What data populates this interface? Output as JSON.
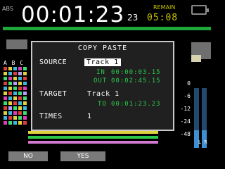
{
  "header": {
    "abs_label": "ABS",
    "time": "00:01:23",
    "frames": "23",
    "remain_label": "REMAIN",
    "remain_time": "05:08",
    "progress": 1.0
  },
  "tracks": {
    "letters": "A B C"
  },
  "dialog": {
    "title": "COPY PASTE",
    "source_label": "SOURCE",
    "source_value": "Track 1",
    "in_label": "IN",
    "in_time": "00:00:03.15",
    "out_label": "OUT",
    "out_time": "00:02:45.15",
    "target_label": "TARGET",
    "target_value": "Track 1",
    "to_label": "TO",
    "to_time": "00:01:23.23",
    "times_label": "TIMES",
    "times_value": "1"
  },
  "meters": {
    "scale": [
      "0",
      "-6",
      "-12",
      "-24",
      "-48"
    ],
    "lr_label": "L R"
  },
  "buttons": {
    "no": "NO",
    "yes": "YES"
  },
  "colors": {
    "time_green": "#2bc84a",
    "remain_yellow": "#c9c400",
    "progress_green": "#1fa83a",
    "meter_blue": "#3d8fd1"
  }
}
